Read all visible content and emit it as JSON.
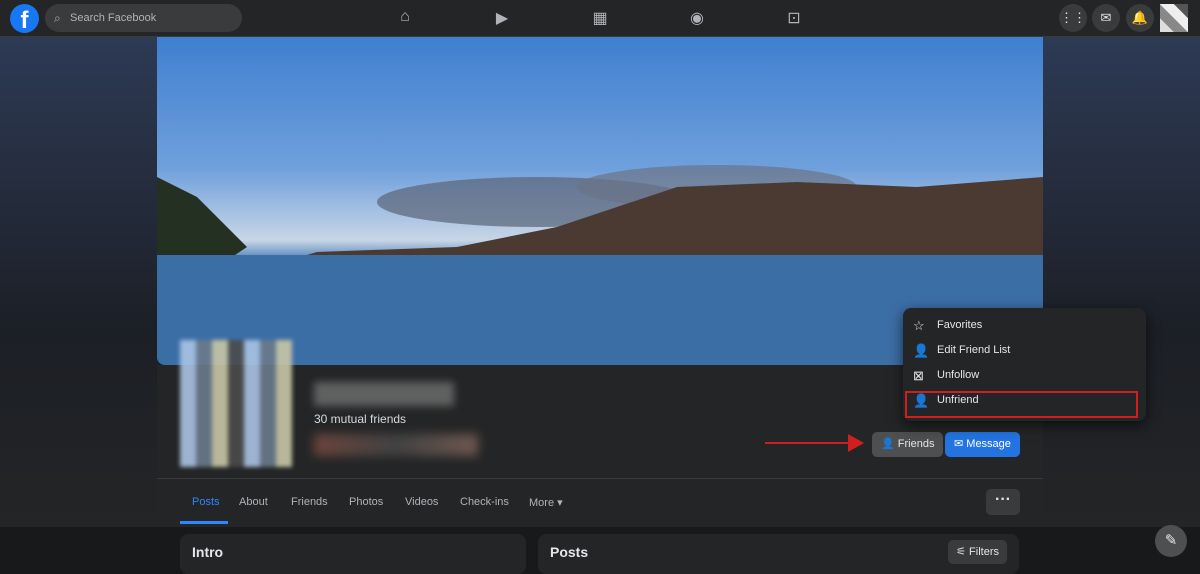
{
  "topbar": {
    "logo": "f",
    "search_placeholder": "Search Facebook",
    "nav_icons": [
      "home-icon",
      "watch-icon",
      "marketplace-icon",
      "groups-icon",
      "gaming-icon"
    ]
  },
  "profile": {
    "mutual_friends": "30 mutual friends",
    "friends_button": "Friends",
    "message_button": "Message"
  },
  "menu": {
    "items": [
      {
        "label": "Favorites",
        "icon": "star-icon"
      },
      {
        "label": "Edit Friend List",
        "icon": "edit-friend-list-icon"
      },
      {
        "label": "Unfollow",
        "icon": "unfollow-icon"
      },
      {
        "label": "Unfriend",
        "icon": "unfriend-icon"
      }
    ]
  },
  "tabs": [
    {
      "label": "Posts"
    },
    {
      "label": "About"
    },
    {
      "label": "Friends"
    },
    {
      "label": "Photos"
    },
    {
      "label": "Videos"
    },
    {
      "label": "Check-ins"
    },
    {
      "label": "More ▾"
    }
  ],
  "more_button": "···",
  "cards": {
    "intro": "Intro",
    "posts": "Posts",
    "filters": "Filters"
  },
  "colors": {
    "accent": "#2d88ff",
    "message": "#2374e1",
    "annotation": "#d01f1f"
  }
}
